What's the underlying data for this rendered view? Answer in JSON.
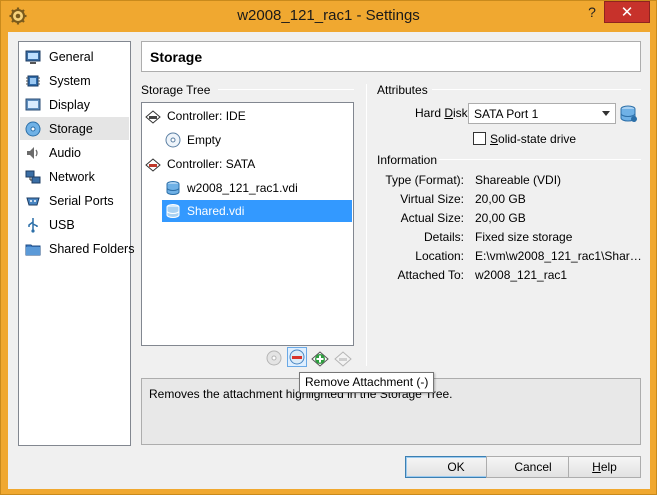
{
  "window": {
    "title": "w2008_121_rac1 - Settings",
    "help_label": "?",
    "close_label": "✕",
    "accent_color": "#f0a830"
  },
  "sidebar": {
    "items": [
      {
        "label": "General",
        "icon": "monitor-icon"
      },
      {
        "label": "System",
        "icon": "chip-icon"
      },
      {
        "label": "Display",
        "icon": "display-icon"
      },
      {
        "label": "Storage",
        "icon": "storage-disk-icon",
        "selected": true
      },
      {
        "label": "Audio",
        "icon": "speaker-icon"
      },
      {
        "label": "Network",
        "icon": "network-icon"
      },
      {
        "label": "Serial Ports",
        "icon": "serial-port-icon"
      },
      {
        "label": "USB",
        "icon": "usb-icon"
      },
      {
        "label": "Shared Folders",
        "icon": "folder-icon"
      }
    ]
  },
  "page": {
    "title": "Storage"
  },
  "storage_tree": {
    "label": "Storage Tree",
    "items": [
      {
        "label": "Controller: IDE",
        "icon": "ide-controller-icon",
        "level": 0
      },
      {
        "label": "Empty",
        "icon": "cd-icon",
        "level": 1
      },
      {
        "label": "Controller: SATA",
        "icon": "sata-controller-icon",
        "level": 0
      },
      {
        "label": "w2008_121_rac1.vdi",
        "icon": "hard-disk-icon",
        "level": 1
      },
      {
        "label": "Shared.vdi",
        "icon": "hard-disk-icon",
        "level": 1,
        "selected": true
      }
    ],
    "toolbar": [
      {
        "name": "add-attachment-disabled-icon",
        "enabled": false
      },
      {
        "name": "remove-attachment-icon",
        "enabled": true,
        "active": true
      },
      {
        "name": "add-controller-icon",
        "enabled": true
      },
      {
        "name": "remove-controller-icon",
        "enabled": false
      }
    ]
  },
  "attributes": {
    "label": "Attributes",
    "hard_disk_label": "Hard Disk:",
    "hard_disk_underline": "D",
    "hard_disk_value": "SATA Port 1",
    "ssd_label": "Solid-state drive",
    "ssd_checked": false
  },
  "information": {
    "label": "Information",
    "rows": [
      {
        "label": "Type (Format):",
        "value": "Shareable (VDI)"
      },
      {
        "label": "Virtual Size:",
        "value": "20,00 GB"
      },
      {
        "label": "Actual Size:",
        "value": "20,00 GB"
      },
      {
        "label": "Details:",
        "value": "Fixed size storage"
      },
      {
        "label": "Location:",
        "value": "E:\\vm\\w2008_121_rac1\\Shared..."
      },
      {
        "label": "Attached To:",
        "value": "w2008_121_rac1"
      }
    ]
  },
  "description": {
    "text": "Removes the attachment highlighted in the Storage Tree.",
    "tooltip": "Remove Attachment (-)"
  },
  "buttons": {
    "ok": "OK",
    "cancel": "Cancel",
    "help": "Help"
  }
}
